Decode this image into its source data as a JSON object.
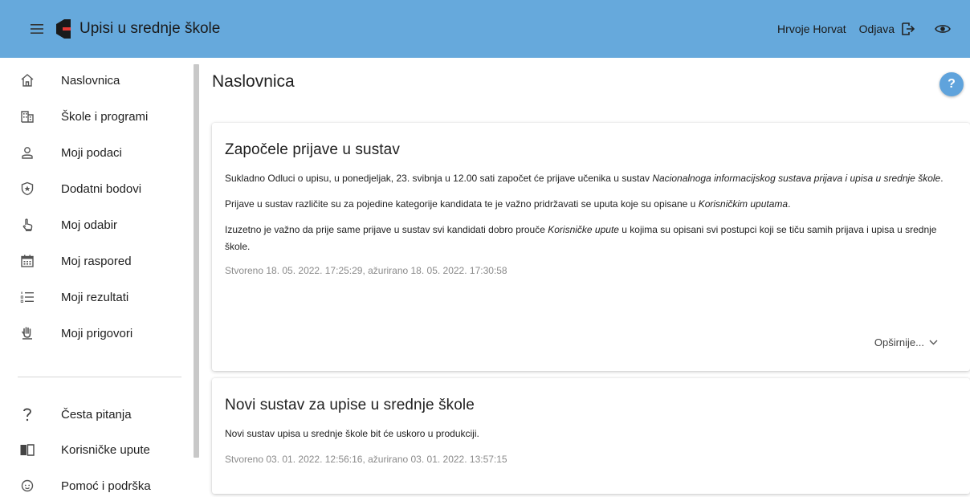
{
  "header": {
    "app_title": "Upisi u srednje škole",
    "user_name": "Hrvoje Horvat",
    "logout_label": "Odjava",
    "menu_icon": "hamburger-menu-icon",
    "logo_icon": "app-logo",
    "logout_icon": "logout-icon",
    "eye_icon": "eye-icon",
    "bar_color": "#66a9dc"
  },
  "sidebar": {
    "items": [
      {
        "label": "Naslovnica",
        "icon": "home-icon"
      },
      {
        "label": "Škole i programi",
        "icon": "building-icon"
      },
      {
        "label": "Moji podaci",
        "icon": "person-icon"
      },
      {
        "label": "Dodatni bodovi",
        "icon": "star-shield-icon"
      },
      {
        "label": "Moj odabir",
        "icon": "hand-pointer-icon"
      },
      {
        "label": "Moj raspored",
        "icon": "calendar-icon"
      },
      {
        "label": "Moji rezultati",
        "icon": "list-icon"
      },
      {
        "label": "Moji prigovori",
        "icon": "raised-hand-icon"
      }
    ],
    "secondary_items": [
      {
        "label": "Česta pitanja",
        "icon": "question-icon"
      },
      {
        "label": "Korisničke upute",
        "icon": "book-icon"
      },
      {
        "label": "Pomoć i podrška",
        "icon": "support-icon"
      }
    ]
  },
  "main": {
    "page_title": "Naslovnica",
    "help_label": "?",
    "cards": [
      {
        "title": "Započele prijave u sustav",
        "p1_a": "Sukladno Odluci o upisu, u ponedjeljak, 23. svibnja u 12.00 sati započet će prijave učenika u sustav ",
        "p1_em": "Nacionalnoga informacijskog sustava prijava i upisa u srednje škole",
        "p1_b": ".",
        "p2_a": "Prijave u sustav različite su za pojedine kategorije kandidata te je važno pridržavati se uputa koje su opisane u ",
        "p2_em": "Korisničkim uputama",
        "p2_b": ".",
        "p3_a": "Izuzetno je važno da prije same prijave u sustav svi kandidati dobro prouče ",
        "p3_em": "Korisničke upute",
        "p3_b": " u kojima su opisani svi postupci koji se tiču samih prijava i upisa u srednje škole.",
        "meta": "Stvoreno 18. 05. 2022. 17:25:29, ažurirano 18. 05. 2022. 17:30:58",
        "more_label": "Opširnije..."
      },
      {
        "title": "Novi sustav za upise u srednje škole",
        "p1": "Novi sustav upisa u srednje škole bit će uskoro u produkciji.",
        "meta": "Stvoreno 03. 01. 2022. 12:56:16, ažurirano 03. 01. 2022. 13:57:15"
      }
    ]
  }
}
